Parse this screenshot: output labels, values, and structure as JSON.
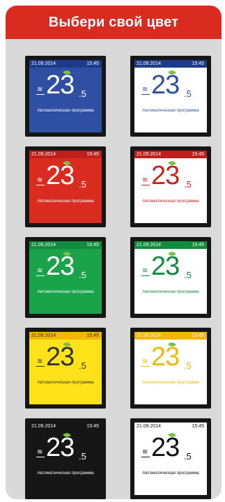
{
  "header": {
    "title": "Выбери свой цвет"
  },
  "display": {
    "date": "21.09.2014",
    "time": "15:45",
    "temp_main": "23",
    "temp_decimal": ".5",
    "heat_icon": "≋",
    "mode_label": "Автоматическая программа"
  },
  "themes": [
    {
      "name": "blue",
      "left": {
        "bar": "#1e3a8a",
        "bg": "#2f4fa3",
        "bar_text": "#ffffff",
        "text": "#ffffff",
        "mode_text": "#ffffff"
      },
      "right": {
        "bar": "#1e3a8a",
        "bg": "#ffffff",
        "bar_text": "#ffffff",
        "text": "#2f4fa3",
        "mode_text": "#2f4fa3"
      }
    },
    {
      "name": "red",
      "left": {
        "bar": "#c0201c",
        "bg": "#d92b20",
        "bar_text": "#ffffff",
        "text": "#ffffff",
        "mode_text": "#ffffff"
      },
      "right": {
        "bar": "#c0201c",
        "bg": "#ffffff",
        "bar_text": "#ffffff",
        "text": "#c8231d",
        "mode_text": "#c8231d"
      }
    },
    {
      "name": "green",
      "left": {
        "bar": "#0f8c3c",
        "bg": "#1aa34a",
        "bar_text": "#ffffff",
        "text": "#ffffff",
        "mode_text": "#ffffff"
      },
      "right": {
        "bar": "#0f8c3c",
        "bg": "#ffffff",
        "bar_text": "#ffffff",
        "text": "#128a3e",
        "mode_text": "#128a3e"
      }
    },
    {
      "name": "yellow",
      "left": {
        "bar": "#f2b705",
        "bg": "#ffe21a",
        "bar_text": "#333333",
        "text": "#333333",
        "mode_text": "#333333"
      },
      "right": {
        "bar": "#f2b705",
        "bg": "#ffffff",
        "bar_text": "#ffffff",
        "text": "#f2b705",
        "mode_text": "#f2b705"
      }
    },
    {
      "name": "black",
      "left": {
        "bar": "#161616",
        "bg": "#161616",
        "bar_text": "#ffffff",
        "text": "#ffffff",
        "mode_text": "#ffffff"
      },
      "right": {
        "bar": "#ffffff",
        "bg": "#ffffff",
        "bar_text": "#111111",
        "text": "#111111",
        "mode_text": "#111111"
      }
    }
  ],
  "accent": {
    "banner": "#d92b20",
    "leaf": "#7cc242",
    "panel": "#d9d9d9"
  }
}
